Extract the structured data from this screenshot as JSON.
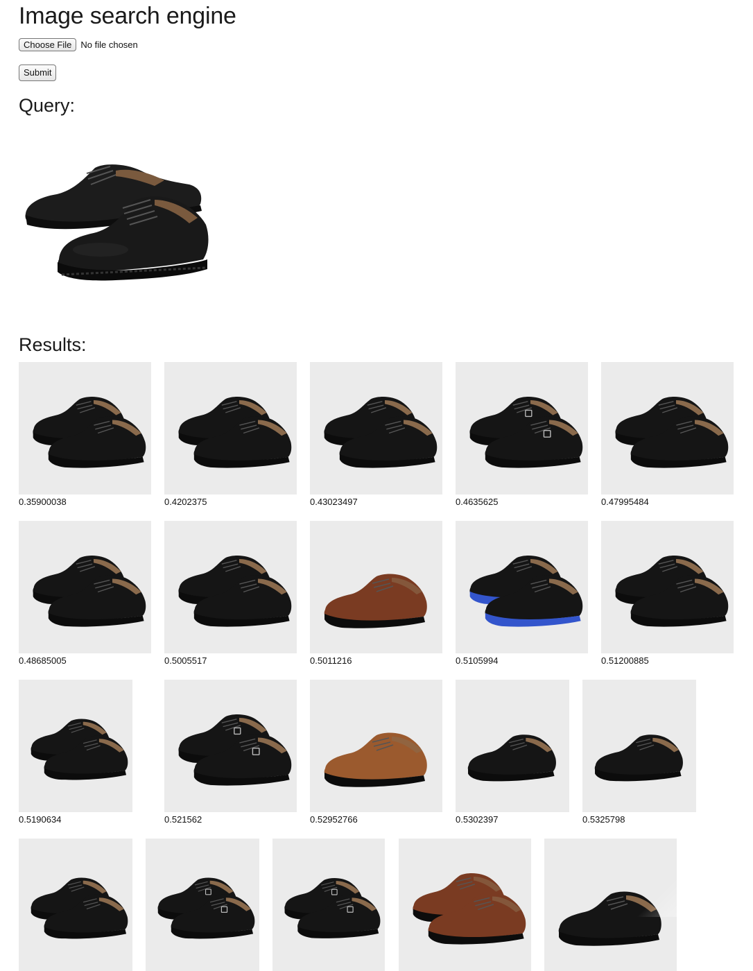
{
  "page": {
    "title": "Image search engine"
  },
  "upload": {
    "choose_label": "Choose File",
    "status": "No file chosen",
    "submit_label": "Submit"
  },
  "query": {
    "heading": "Query:",
    "image_icon": "derby-shoe-pair-black"
  },
  "results": {
    "heading": "Results:",
    "items": [
      {
        "score": "0.35900038",
        "shoe": "black-derby-pair"
      },
      {
        "score": "0.4202375",
        "shoe": "black-derby-pair"
      },
      {
        "score": "0.43023497",
        "shoe": "black-derby-pair"
      },
      {
        "score": "0.4635625",
        "shoe": "black-monk-strap-pair"
      },
      {
        "score": "0.47995484",
        "shoe": "black-derby-pair"
      },
      {
        "score": "0.48685005",
        "shoe": "black-derby-pair"
      },
      {
        "score": "0.5005517",
        "shoe": "black-derby-pair"
      },
      {
        "score": "0.5011216",
        "shoe": "brown-derby-single"
      },
      {
        "score": "0.5105994",
        "shoe": "black-slip-on-blue-sole"
      },
      {
        "score": "0.51200885",
        "shoe": "black-derby-pair"
      },
      {
        "score": "0.5190634",
        "shoe": "black-derby-pair"
      },
      {
        "score": "0.521562",
        "shoe": "black-double-monk-pair"
      },
      {
        "score": "0.52952766",
        "shoe": "tan-cap-toe-single"
      },
      {
        "score": "0.5302397",
        "shoe": "black-moc-toe-single"
      },
      {
        "score": "0.5325798",
        "shoe": "black-moc-toe-single"
      },
      {
        "score": "",
        "shoe": "black-derby-pair"
      },
      {
        "score": "",
        "shoe": "black-monk-strap-pair"
      },
      {
        "score": "",
        "shoe": "black-monk-strap-pair"
      },
      {
        "score": "",
        "shoe": "brown-moc-toe-pair"
      },
      {
        "score": "",
        "shoe": "black-derby-single"
      }
    ]
  },
  "colors": {
    "thumb_background": "#ebebeb",
    "shoe_black": "#151515",
    "shoe_brown": "#7a3b22",
    "shoe_tan": "#9b5a2e",
    "sole_blue": "#3355cc"
  }
}
